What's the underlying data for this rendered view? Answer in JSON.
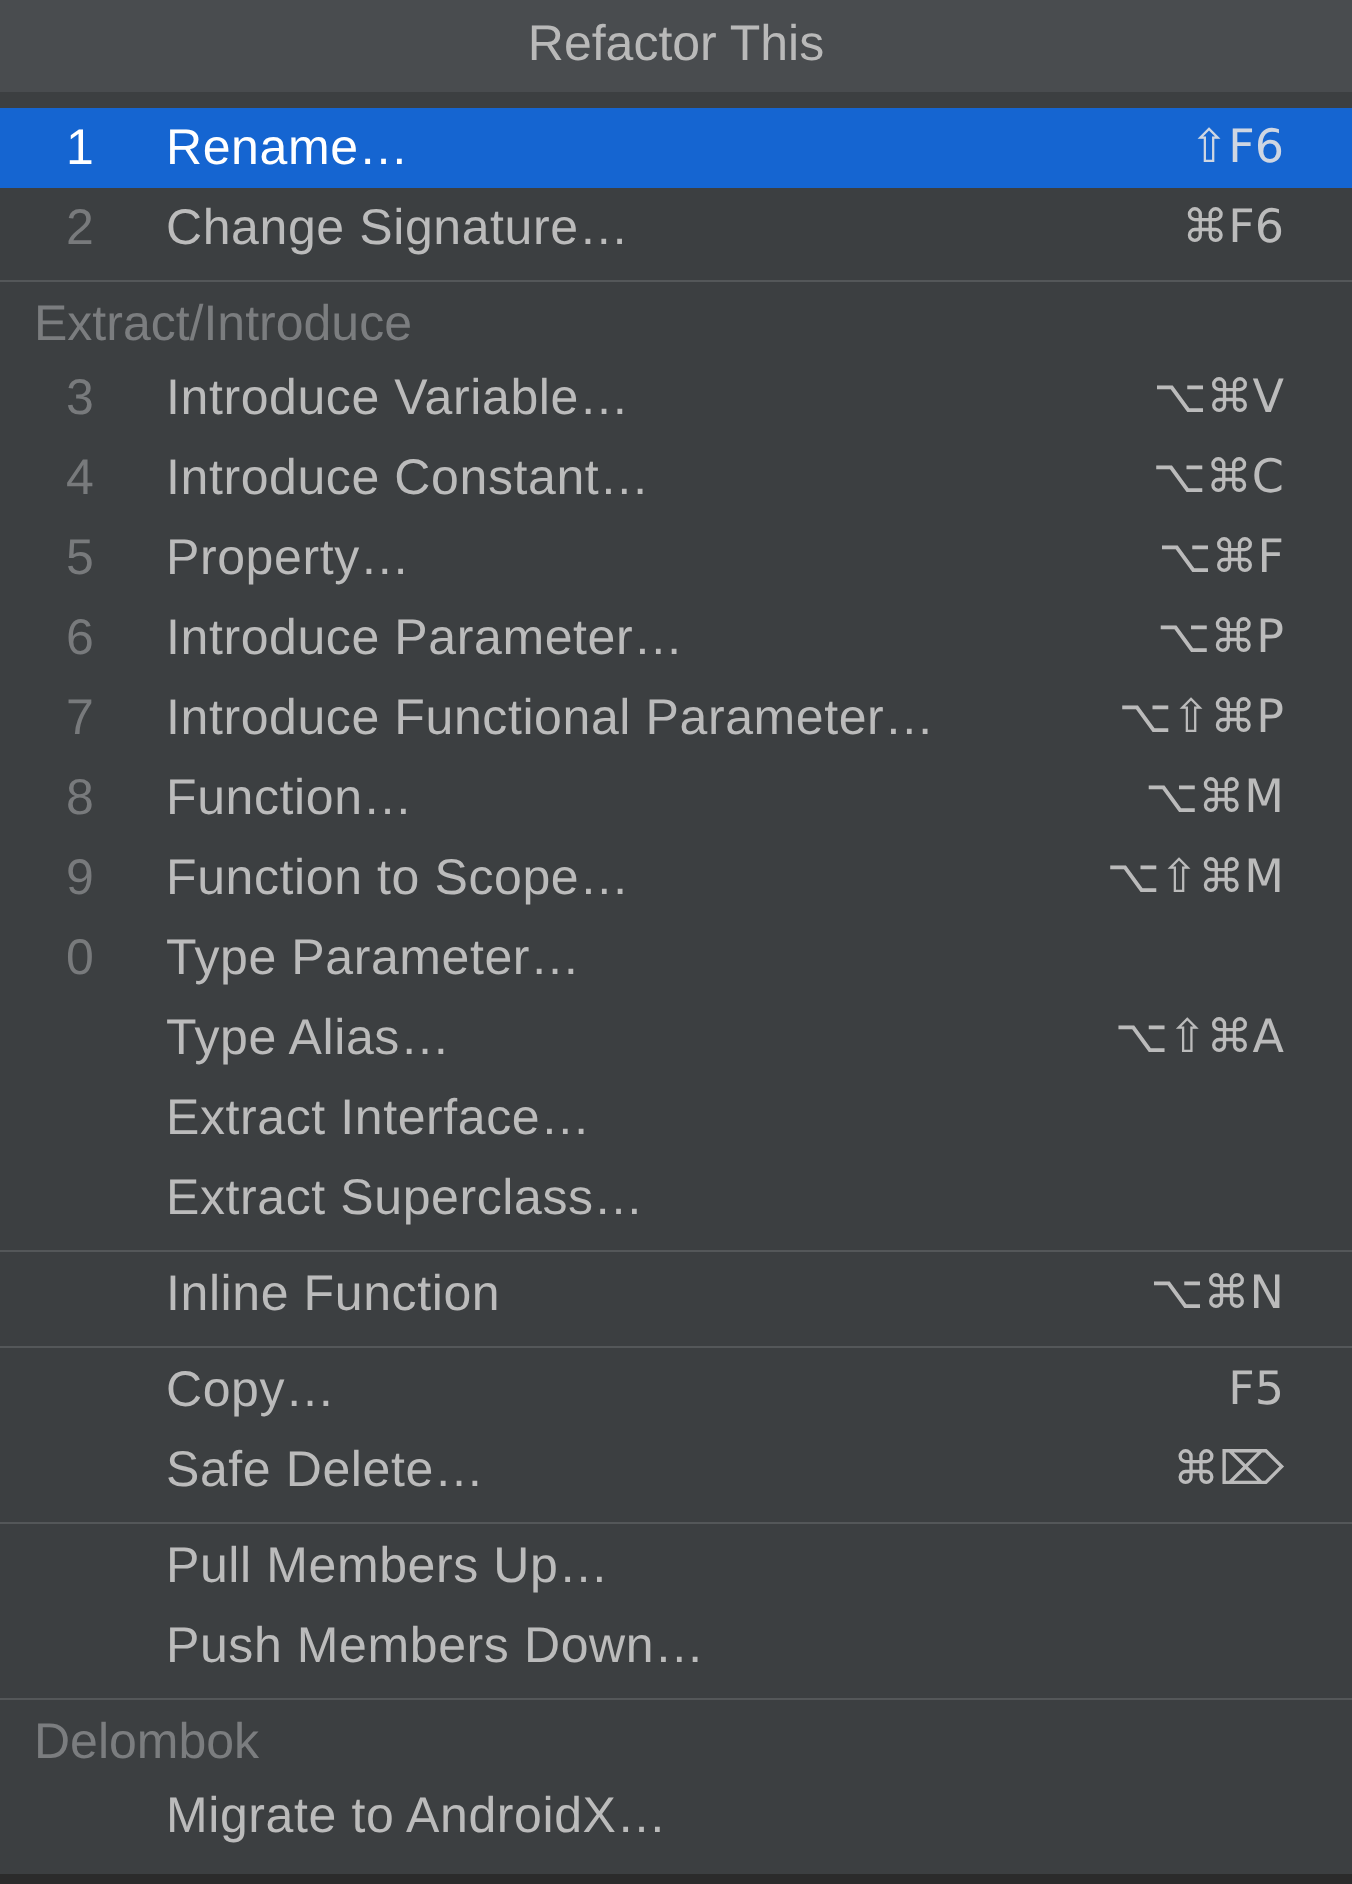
{
  "title": "Refactor This",
  "groups": [
    {
      "items": [
        {
          "number": "1",
          "label": "Rename…",
          "shortcut": "⇧F6",
          "selected": true
        },
        {
          "number": "2",
          "label": "Change Signature…",
          "shortcut": "⌘F6",
          "selected": false
        }
      ]
    },
    {
      "header": "Extract/Introduce",
      "items": [
        {
          "number": "3",
          "label": "Introduce Variable…",
          "shortcut": "⌥⌘V",
          "selected": false
        },
        {
          "number": "4",
          "label": "Introduce Constant…",
          "shortcut": "⌥⌘C",
          "selected": false
        },
        {
          "number": "5",
          "label": "Property…",
          "shortcut": "⌥⌘F",
          "selected": false
        },
        {
          "number": "6",
          "label": "Introduce Parameter…",
          "shortcut": "⌥⌘P",
          "selected": false
        },
        {
          "number": "7",
          "label": "Introduce Functional Parameter…",
          "shortcut": "⌥⇧⌘P",
          "selected": false
        },
        {
          "number": "8",
          "label": "Function…",
          "shortcut": "⌥⌘M",
          "selected": false
        },
        {
          "number": "9",
          "label": "Function to Scope…",
          "shortcut": "⌥⇧⌘M",
          "selected": false
        },
        {
          "number": "0",
          "label": "Type Parameter…",
          "selected": false
        },
        {
          "label": "Type Alias…",
          "shortcut": "⌥⇧⌘A",
          "selected": false
        },
        {
          "label": "Extract Interface…",
          "selected": false
        },
        {
          "label": "Extract Superclass…",
          "selected": false
        }
      ]
    },
    {
      "items": [
        {
          "label": "Inline Function",
          "shortcut": "⌥⌘N",
          "selected": false
        }
      ]
    },
    {
      "items": [
        {
          "label": "Copy…",
          "shortcut": "F5",
          "selected": false
        },
        {
          "label": "Safe Delete…",
          "shortcut": "⌘⌦",
          "selected": false
        }
      ]
    },
    {
      "items": [
        {
          "label": "Pull Members Up…",
          "selected": false
        },
        {
          "label": "Push Members Down…",
          "selected": false
        }
      ]
    },
    {
      "header": "Delombok",
      "items": [
        {
          "label": "Migrate to AndroidX…",
          "selected": false
        }
      ]
    }
  ]
}
